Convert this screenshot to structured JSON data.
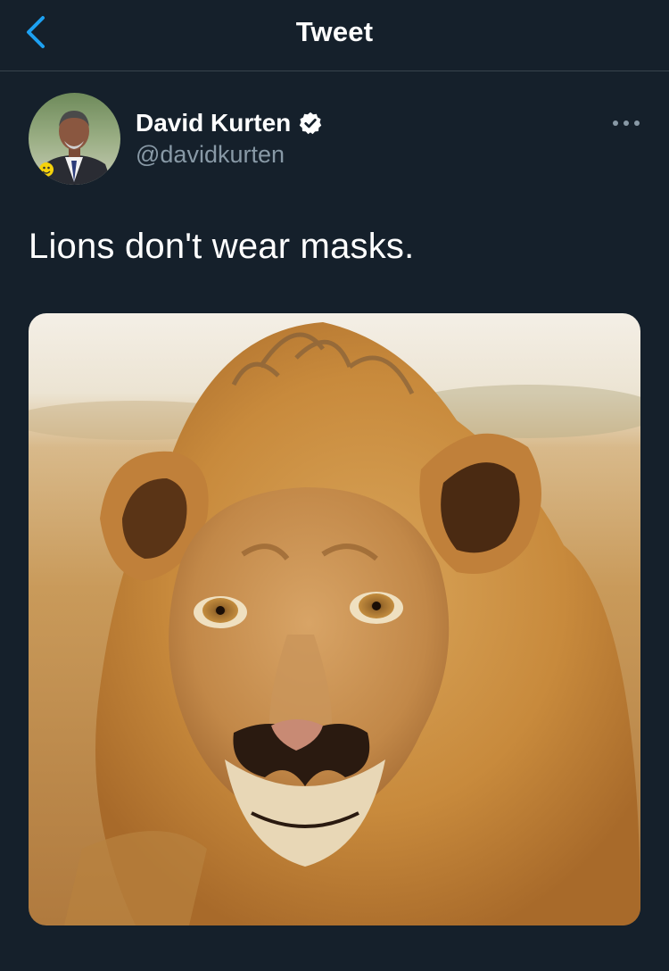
{
  "header": {
    "title": "Tweet",
    "back_icon": "chevron-left-icon",
    "accent": "#1da1f2"
  },
  "tweet": {
    "author": {
      "display_name": "David Kurten",
      "handle": "@davidkurten",
      "verified": true,
      "verified_icon": "verified-badge-icon"
    },
    "more_icon": "more-dots-icon",
    "text": "Lions don't wear masks.",
    "media": {
      "type": "photo",
      "icon": "lion-photo"
    }
  },
  "colors": {
    "background": "#15202b",
    "divider": "#38444d",
    "secondary_text": "#8899a6",
    "primary_text": "#ffffff"
  }
}
